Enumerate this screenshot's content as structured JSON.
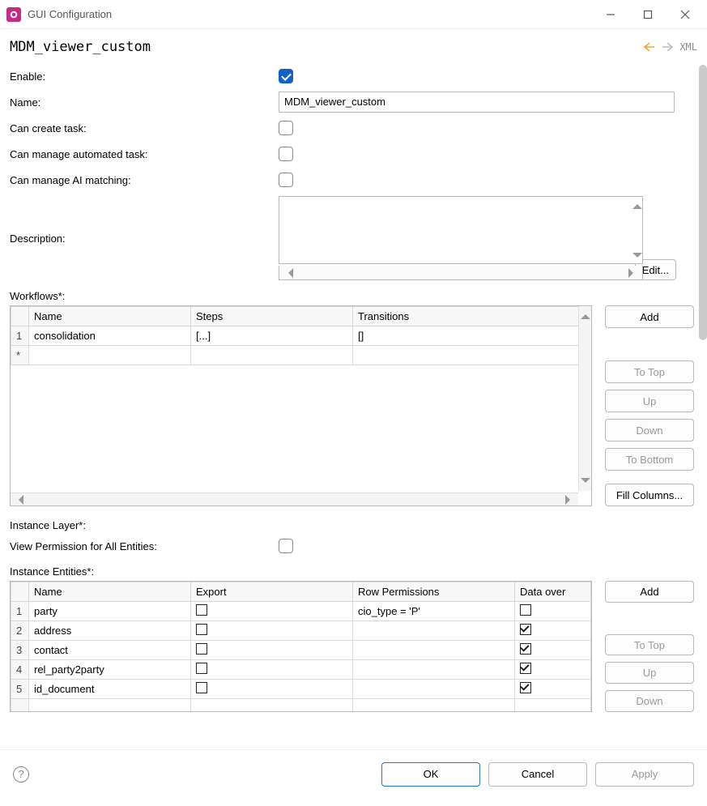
{
  "window": {
    "title": "GUI Configuration",
    "min_label": "–",
    "max_label": "▢",
    "close_label": "✕"
  },
  "header": {
    "page_title": "MDM_viewer_custom",
    "xml_link": "XML"
  },
  "fields": {
    "enable": {
      "label": "Enable:",
      "checked": true
    },
    "name": {
      "label": "Name:",
      "value": "MDM_viewer_custom"
    },
    "can_create_task": {
      "label": "Can create task:",
      "checked": false
    },
    "can_manage_automated_task": {
      "label": "Can manage automated task:",
      "checked": false
    },
    "can_manage_ai_matching": {
      "label": "Can manage AI matching:",
      "checked": false
    },
    "description": {
      "label": "Description:",
      "value": "",
      "edit_button": "Edit..."
    },
    "workflows_label": "Workflows*:",
    "instance_layer_label": "Instance Layer*:",
    "view_perm_all": {
      "label": "View Permission for All Entities:",
      "checked": false
    },
    "instance_entities_label": "Instance Entities*:"
  },
  "workflows": {
    "columns": {
      "name": "Name",
      "steps": "Steps",
      "transitions": "Transitions"
    },
    "rows": [
      {
        "num": "1",
        "name": "consolidation",
        "steps": "[...]",
        "transitions": "[]"
      },
      {
        "num": "*",
        "name": "",
        "steps": "",
        "transitions": ""
      }
    ]
  },
  "entities": {
    "columns": {
      "name": "Name",
      "export": "Export",
      "row_perm": "Row Permissions",
      "data_over": "Data over"
    },
    "rows": [
      {
        "num": "1",
        "name": "party",
        "export": false,
        "row_perm": "cio_type = 'P'",
        "data_over": false
      },
      {
        "num": "2",
        "name": "address",
        "export": false,
        "row_perm": "",
        "data_over": true
      },
      {
        "num": "3",
        "name": "contact",
        "export": false,
        "row_perm": "",
        "data_over": true
      },
      {
        "num": "4",
        "name": "rel_party2party",
        "export": false,
        "row_perm": "",
        "data_over": true
      },
      {
        "num": "5",
        "name": "id_document",
        "export": false,
        "row_perm": "",
        "data_over": true
      }
    ]
  },
  "side_buttons": {
    "add": "Add",
    "to_top": "To Top",
    "up": "Up",
    "down": "Down",
    "to_bottom": "To Bottom",
    "fill_columns": "Fill Columns..."
  },
  "footer": {
    "ok": "OK",
    "cancel": "Cancel",
    "apply": "Apply"
  }
}
